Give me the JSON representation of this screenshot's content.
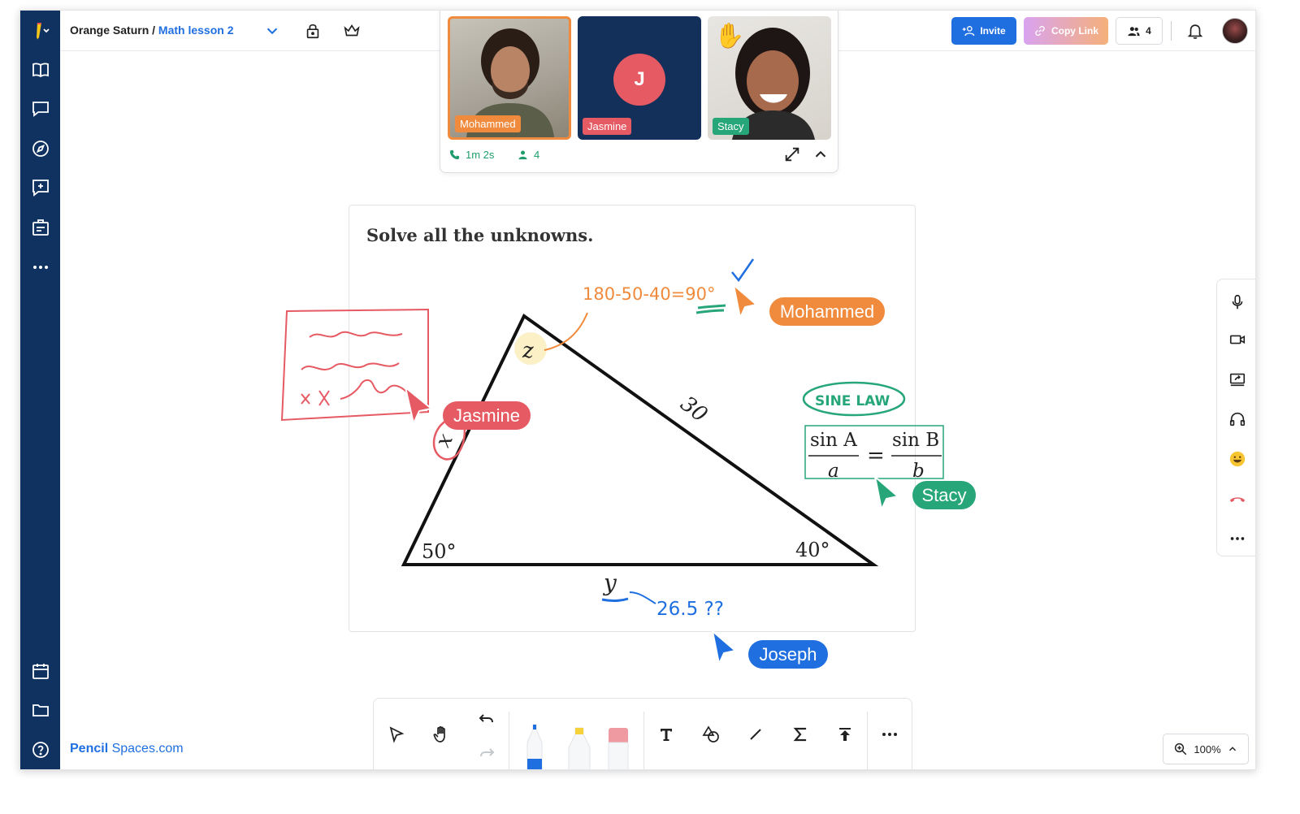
{
  "breadcrumb": {
    "space": "Orange Saturn",
    "separator": " / ",
    "lesson": "Math lesson 2"
  },
  "header": {
    "invite_label": "Invite",
    "copy_link_label": "Copy Link",
    "participant_count": "4"
  },
  "video": {
    "participants": [
      {
        "name": "Mohammed",
        "color": "#f08a3c"
      },
      {
        "name": "Jasmine",
        "initial": "J",
        "color": "#e65a63"
      },
      {
        "name": "Stacy",
        "color": "#27a67a"
      }
    ],
    "call_duration": "1m 2s",
    "attendees": "4"
  },
  "board": {
    "prompt": "Solve all the unknowns.",
    "triangle": {
      "angle_bottom_left": "50°",
      "angle_bottom_right": "40°",
      "side_hypotenuse": "30",
      "top_vertex_var": "z",
      "left_side_var": "x",
      "bottom_side_var": "y"
    },
    "annotations": {
      "orange_equation": "180-50-40=90°",
      "sine_law_label": "SINE LAW",
      "sine_formula": {
        "num_left": "sin A",
        "den_left": "a",
        "equals": "=",
        "num_right": "sin B",
        "den_right": "b"
      },
      "blue_guess": "26.5 ??"
    },
    "cursors": [
      {
        "name": "Mohammed",
        "color": "#f08a3c"
      },
      {
        "name": "Jasmine",
        "color": "#e65a63"
      },
      {
        "name": "Stacy",
        "color": "#27a67a"
      },
      {
        "name": "Joseph",
        "color": "#1f6fe0"
      }
    ]
  },
  "footer": {
    "brand_bold": "Pencil",
    "brand_rest": " Spaces.com",
    "zoom": "100%"
  },
  "colors": {
    "sidebar": "#0f3261",
    "accent": "#1f6fe0",
    "orange": "#f08a3c",
    "red": "#e65a63",
    "green": "#27a67a"
  }
}
